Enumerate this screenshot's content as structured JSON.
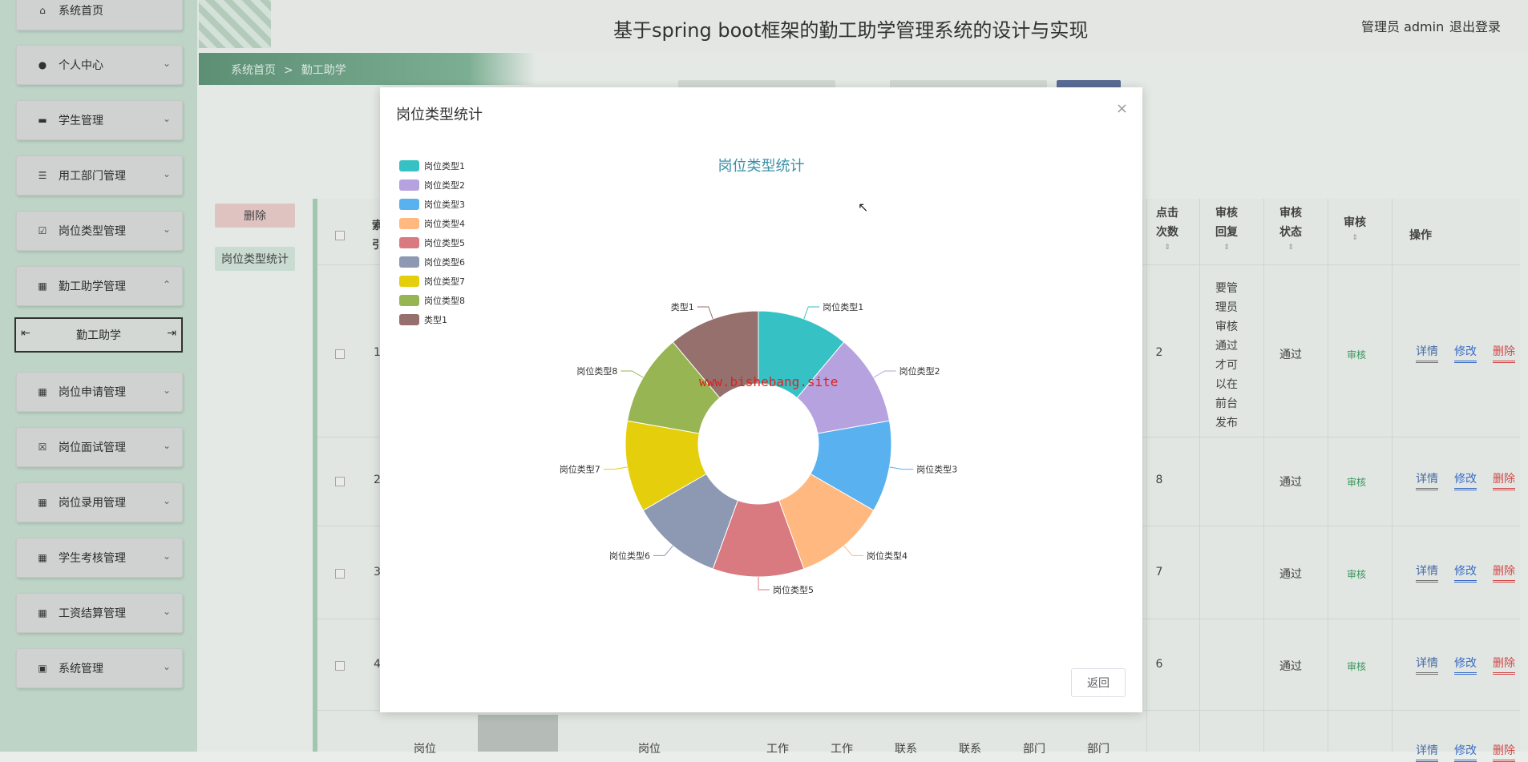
{
  "app": {
    "title": "基于spring boot框架的勤工助学管理系统的设计与实现",
    "user": "管理员 admin",
    "logout": "退出登录"
  },
  "breadcrumb": {
    "home": "系统首页",
    "sep": ">",
    "current": "勤工助学"
  },
  "sidebar": {
    "items": [
      {
        "label": "系统首页",
        "icon": "home-icon"
      },
      {
        "label": "个人中心",
        "icon": "user-icon"
      },
      {
        "label": "学生管理",
        "icon": "monitor-icon"
      },
      {
        "label": "用工部门管理",
        "icon": "list-icon"
      },
      {
        "label": "岗位类型管理",
        "icon": "clipboard-check-icon"
      },
      {
        "label": "勤工助学管理",
        "icon": "grid-icon"
      },
      {
        "label": "岗位申请管理",
        "icon": "grid-icon"
      },
      {
        "label": "岗位面试管理",
        "icon": "clipboard-x-icon"
      },
      {
        "label": "岗位录用管理",
        "icon": "grid-icon"
      },
      {
        "label": "学生考核管理",
        "icon": "grid-icon"
      },
      {
        "label": "工资结算管理",
        "icon": "grid-icon"
      },
      {
        "label": "系统管理",
        "icon": "briefcase-icon"
      }
    ],
    "sub_item": "勤工助学"
  },
  "background": {
    "delete_btn": "删除",
    "stat_btn": "岗位类型统计",
    "headers": {
      "clicks_a": "点击",
      "clicks_b": "次数",
      "reply_a": "审核",
      "reply_b": "回复",
      "status_a": "审核",
      "status_b": "状态",
      "audit": "审核",
      "ops": "操作"
    },
    "rows": [
      {
        "num": "1",
        "clicks": "2",
        "reply": "要管\n理员\n审核\n通过\n才可\n以在\n前台\n发布",
        "status": "通过",
        "audit": "审核"
      },
      {
        "num": "2",
        "clicks": "8",
        "reply": "",
        "status": "通过",
        "audit": "审核"
      },
      {
        "num": "3",
        "clicks": "7",
        "reply": "",
        "status": "通过",
        "audit": "审核"
      },
      {
        "num": "4",
        "clicks": "6",
        "reply": "",
        "status": "通过",
        "audit": "审核"
      }
    ],
    "actions": {
      "detail": "详情",
      "edit": "修改",
      "delete": "删除"
    },
    "bottom_row": [
      "岗位",
      "岗位",
      "工作",
      "工作",
      "联系",
      "联系",
      "部门",
      "部门"
    ],
    "partial_header": [
      "索",
      "引"
    ]
  },
  "modal": {
    "title": "岗位类型统计",
    "close": "×",
    "back": "返回",
    "watermark": "www.bishebang.site"
  },
  "chart_data": {
    "type": "pie",
    "title": "岗位类型统计",
    "donut": true,
    "legend_position": "top-left",
    "categories": [
      "岗位类型1",
      "岗位类型2",
      "岗位类型3",
      "岗位类型4",
      "岗位类型5",
      "岗位类型6",
      "岗位类型7",
      "岗位类型8",
      "类型1"
    ],
    "values": [
      1,
      1,
      1,
      1,
      1,
      1,
      1,
      1,
      1
    ],
    "colors": [
      "#36c2c5",
      "#b6a2de",
      "#5ab1ef",
      "#ffb980",
      "#d87a80",
      "#8d98b3",
      "#e5cf0d",
      "#97b552",
      "#95706d"
    ]
  }
}
